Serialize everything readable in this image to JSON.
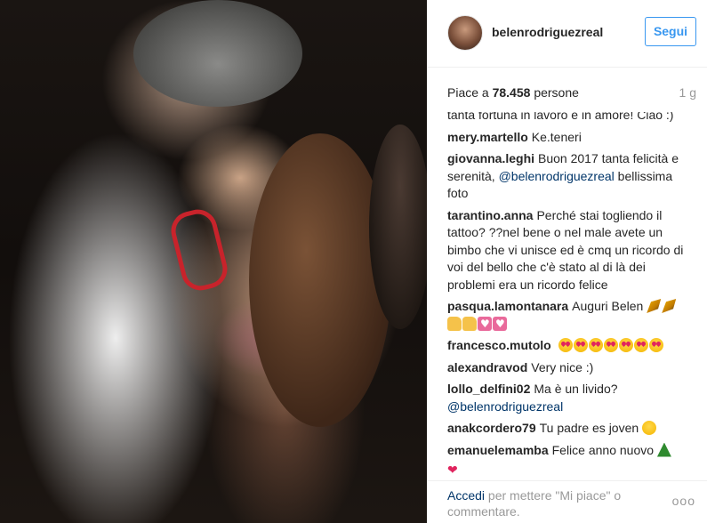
{
  "post": {
    "username": "belenrodriguezreal",
    "follow_label": "Segui",
    "likes_prefix": "Piace a",
    "likes_count": "78.458",
    "likes_suffix": "persone",
    "time_ago": "1 g"
  },
  "comments": [
    {
      "author": "",
      "text": "tanta fortuna in lavoro e in amore! Ciao :)"
    },
    {
      "author": "mery.martello",
      "text": "Ke.teneri"
    },
    {
      "author": "giovanna.leghi",
      "text": "Buon 2017 tanta felicità e serenità,",
      "mention": "@belenrodriguezreal",
      "text_after": "bellissima foto"
    },
    {
      "author": "tarantino.anna",
      "text": "Perché stai togliendo il tattoo? ??nel bene o nel male avete un bimbo che vi unisce ed è cmq un ricordo di voi del bello che c'è stato al di là dei problemi era un ricordo felice"
    },
    {
      "author": "pasqua.lamontanara",
      "text": "Auguri Belen"
    },
    {
      "author": "francesco.mutolo",
      "text": ""
    },
    {
      "author": "alexandravod",
      "text": "Very nice :)"
    },
    {
      "author": "lollo_delfini02",
      "text": "Ma è un livido?",
      "mention": "@belenrodriguezreal"
    },
    {
      "author": "anakcordero79",
      "text": "Tu padre es joven"
    },
    {
      "author": "emanuelemamba",
      "text": "Felice anno nuovo"
    }
  ],
  "footer": {
    "login_link": "Accedi",
    "login_rest": "per mettere \"Mi piace\" o commentare.",
    "more_label": "ooo"
  },
  "colors": {
    "accent": "#3897f0",
    "link": "#003569",
    "muted": "#999999",
    "text": "#262626"
  }
}
